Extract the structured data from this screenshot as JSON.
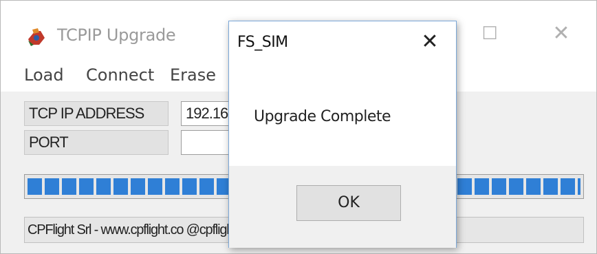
{
  "main_window": {
    "title": "TCPIP Upgrade",
    "icon": "app-logo-icon",
    "max_glyph": "☐",
    "close_glyph": "✕"
  },
  "menu": {
    "items": [
      "Load",
      "Connect",
      "Erase"
    ]
  },
  "fields": {
    "ip_label": "TCP IP ADDRESS",
    "ip_value": "192.16",
    "port_label": "PORT",
    "port_value": ""
  },
  "progress": {
    "value_percent": 100
  },
  "status": {
    "text": "CPFlight Srl - www.cpflight.co                                   @cpflight.com"
  },
  "dialog": {
    "title": "FS_SIM",
    "close_glyph": "✕",
    "message": "Upgrade Complete",
    "ok_label": "OK"
  }
}
